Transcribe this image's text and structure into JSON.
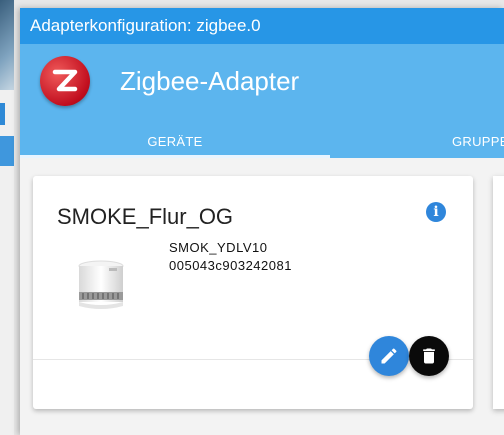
{
  "window": {
    "title": "Adapterkonfiguration: zigbee.0"
  },
  "header": {
    "app_title": "Zigbee-Adapter",
    "logo_icon": "zigbee-logo-icon"
  },
  "tabs": [
    {
      "label": "GERÄTE",
      "active": true
    },
    {
      "label": "GRUPPE"
    }
  ],
  "device": {
    "name": "SMOKE_Flur_OG",
    "model": "SMOK_YDLV10",
    "ieee": "005043c903242081",
    "image_icon": "smoke-detector-icon"
  },
  "icons": {
    "info": "info-icon",
    "edit": "pencil-icon",
    "delete": "trash-icon",
    "info_glyph": "i"
  },
  "colors": {
    "titlebar": "#2796e6",
    "header": "#5cb5ee",
    "accent_blue": "#2f86db",
    "delete_button": "#0a0a0a"
  }
}
